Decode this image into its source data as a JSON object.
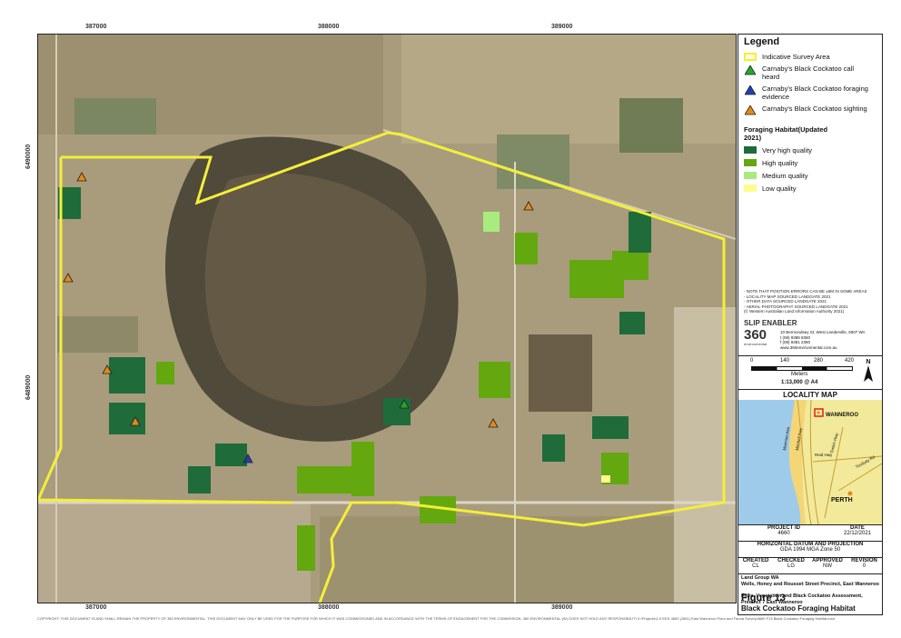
{
  "map": {
    "easting_labels": [
      "387000",
      "388000",
      "389000"
    ],
    "northing_labels": [
      "6490000",
      "6489000"
    ]
  },
  "legend": {
    "title": "Legend",
    "items": [
      {
        "label": "Indicative Survey Area",
        "color": "#f5ee3a"
      },
      {
        "label": "Carnaby's Black Cockatoo call heard",
        "color": "#22a82a"
      },
      {
        "label": "Carnaby's Black Cockatoo foraging evidence",
        "color": "#1f3fb6"
      },
      {
        "label": "Carnaby's Black Cockatoo sighting",
        "color": "#e48a18"
      }
    ],
    "habitat_heading": "Foraging Habitat(Updated 2021)",
    "habitat_classes": [
      {
        "label": "Very high quality",
        "color": "#1f6b3a"
      },
      {
        "label": "High quality",
        "color": "#63a80f"
      },
      {
        "label": "Medium quality",
        "color": "#a7ec7d"
      },
      {
        "label": "Low quality",
        "color": "#fffb8c"
      }
    ]
  },
  "notes": [
    "- NOTE THAT POSITION ERRORS CAN BE ±5M IN SOME AREAS",
    "- LOCALITY MAP SOURCED LANDGATE 2021",
    "- OTHER DATA SOURCED LANDGATE 2021",
    "- AERIAL PHOTOGRAPHY SOURCED LANDGATE 2021",
    "(© Western Australian Land Information Authority 2021)"
  ],
  "branding": {
    "slip_label": "SLIP ENABLER",
    "company_logo": "360",
    "company_sub": "environmental",
    "address": "10 Bermondsey St, West Leederville, 6007 WA",
    "phone_t": "t (08) 9388 8360",
    "phone_f": "f (08) 9381 2360",
    "web": "www.360environmental.com.au"
  },
  "scale_bar": {
    "ticks": [
      "0",
      "140",
      "280",
      "420"
    ],
    "unit": "Meters",
    "ratio": "1:13,000 @ A4",
    "north": "N"
  },
  "locality_map": {
    "title": "LOCALITY MAP",
    "labels": [
      "WANNEROO",
      "Marmion Ave",
      "Mitchell Fwy",
      "Reid Hwy",
      "Tonkin Hwy",
      "Toodyay Rd",
      "PERTH"
    ]
  },
  "title_block": {
    "project_id_label": "PROJECT ID",
    "project_id": "4660",
    "date_label": "DATE",
    "date": "22/12/2021",
    "datum_heading": "HORIZONTAL DATUM AND PROJECTION",
    "datum": "GDA 1994 MGA Zone 50",
    "headers": [
      "CREATED",
      "CHECKED",
      "APPROVED",
      "REVISION"
    ],
    "values": [
      "CL",
      "LG",
      "NW",
      "0"
    ],
    "client": "Land Group WA",
    "client_project": "Wells, Honey and Rousset Street Precinct, East Wanneroo",
    "report": "Flora, Vegetation and Black Cockatoo Assessment, Precinct 7 East Wanneroo",
    "figure_no": "Figure 13",
    "figure_title": "Black Cockatoo Foraging Habitat"
  },
  "footer": {
    "copyright": "COPYRIGHT: THIS DOCUMENT IS AND SHALL REMAIN THE PROPERTY OF 360 ENVIRONMENTAL. THIS DOCUMENT MAY ONLY BE USED FOR THE PURPOSE FOR WHICH IT WAS COMMISSIONED AND IN ACCORDANCE WITH THE TERMS OF ENGAGEMENT FOR THE COMMISSION. 360 ENVIRONMENTAL (W) DOES NOT HOLD ANY RESPONSIBILITY FOR THE MISUSE OF THIS DOCUMENT.",
    "path": "K:\\Projects\\1-9 EES-4660 (J661) East Wanneroo Flora and Fauna Survey\\4660 F13 Black Cockatoo Foraging Habitat.mxd"
  }
}
